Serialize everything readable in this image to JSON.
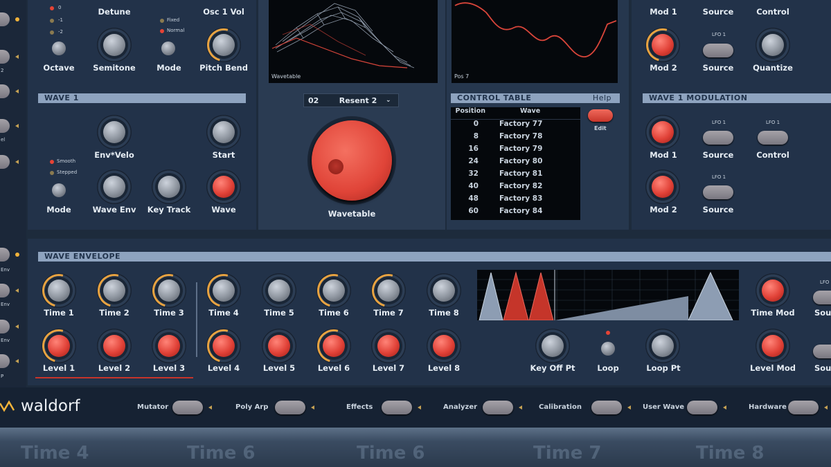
{
  "osc": {
    "octave_opts": [
      "0",
      "-1",
      "-2"
    ],
    "labels": {
      "detune": "Detune",
      "osc1_vol": "Osc 1 Vol",
      "octave": "Octave",
      "semitone": "Semitone",
      "mode": "Mode",
      "pitch_bend": "Pitch Bend"
    },
    "mode_opts": [
      "Fixed",
      "Normal"
    ]
  },
  "wave1": {
    "title": "WAVE 1",
    "labels": {
      "env_velo": "Env*Velo",
      "start": "Start",
      "mode": "Mode",
      "wave_env": "Wave Env",
      "key_track": "Key Track",
      "wave": "Wave"
    },
    "mode_opts": [
      "Smooth",
      "Stepped"
    ]
  },
  "display": {
    "wavetable_caption": "Wavetable",
    "pos_caption": "Pos 7"
  },
  "wavetable_selector": {
    "number": "02",
    "name": "Resent 2"
  },
  "wavetable_knob_label": "Wavetable",
  "control_table": {
    "title": "CONTROL TABLE",
    "help": "Help",
    "edit": "Edit",
    "headers": [
      "Position",
      "Wave"
    ],
    "rows": [
      {
        "pos": "0",
        "wave": "Factory 77"
      },
      {
        "pos": "8",
        "wave": "Factory 78"
      },
      {
        "pos": "16",
        "wave": "Factory 79"
      },
      {
        "pos": "24",
        "wave": "Factory 80"
      },
      {
        "pos": "32",
        "wave": "Factory 81"
      },
      {
        "pos": "40",
        "wave": "Factory 82"
      },
      {
        "pos": "48",
        "wave": "Factory 83"
      },
      {
        "pos": "60",
        "wave": "Factory 84"
      }
    ]
  },
  "top_right": {
    "mod1": "Mod 1",
    "source": "Source",
    "control": "Control",
    "mod2": "Mod 2",
    "source2": "Source",
    "quantize": "Quantize",
    "lfo": "LFO 1"
  },
  "wave1_mod": {
    "title": "WAVE 1 MODULATION",
    "mod1": "Mod 1",
    "source": "Source",
    "control": "Control",
    "mod2": "Mod 2",
    "source2": "Source",
    "lfo": "LFO 1"
  },
  "wave_env": {
    "title": "WAVE ENVELOPE",
    "times": [
      "Time 1",
      "Time 2",
      "Time 3",
      "Time 4",
      "Time 5",
      "Time 6",
      "Time 7",
      "Time 8"
    ],
    "levels": [
      "Level 1",
      "Level 2",
      "Level 3",
      "Level 4",
      "Level 5",
      "Level 6",
      "Level 7",
      "Level 8"
    ],
    "key_off_pt": "Key Off Pt",
    "loop": "Loop",
    "loop_pt": "Loop Pt",
    "time_mod": "Time Mod",
    "level_mod": "Level Mod",
    "source_partial": "Sou",
    "lfo_partial": "LFO"
  },
  "sidebar": {
    "labels": [
      "2",
      "F",
      "el",
      "o",
      "Env",
      "Env",
      "Env",
      "P"
    ]
  },
  "footer": {
    "brand": "waldorf",
    "items": [
      "Mutator",
      "Poly Arp",
      "Effects",
      "Analyzer",
      "Calibration",
      "User Wave",
      "Hardware"
    ]
  },
  "reflection": {
    "labels": [
      "Time 4",
      "Time 6",
      "Time 6",
      "Time 7",
      "Time 8"
    ]
  }
}
